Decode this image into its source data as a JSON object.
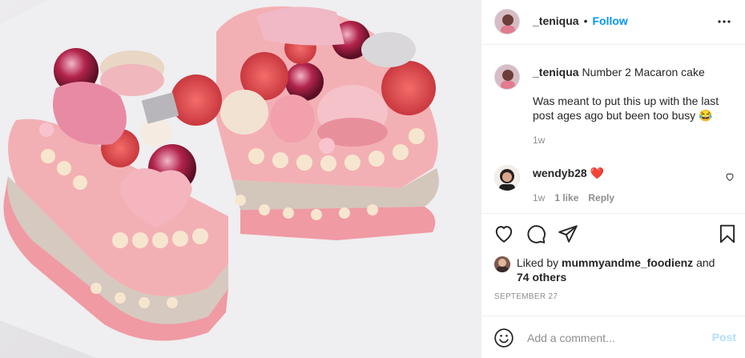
{
  "post": {
    "author": "_teniqua",
    "separator": "•",
    "follow_label": "Follow",
    "more_icon": "more-options-icon",
    "caption": {
      "username": "_teniqua",
      "title": "Number 2 Macaron cake",
      "body": "Was meant to put this up with the last post ages ago but been too busy 😂",
      "time": "1w"
    },
    "comments": [
      {
        "username": "wendyb28",
        "text": "❤️",
        "time": "1w",
        "likes": "1 like",
        "reply": "Reply"
      }
    ],
    "liked_by_prefix": "Liked by",
    "liked_by_user": "mummyandme_foodienz",
    "liked_by_suffix": "and",
    "liked_others": "74 others",
    "date": "SEPTEMBER 27",
    "add_comment_placeholder": "Add a comment...",
    "post_label": "Post"
  },
  "colors": {
    "accent": "#0095f6",
    "post_disabled": "#b2dffc",
    "heart_red": "#ed4956",
    "cake_pink": "#f2a6ab"
  }
}
